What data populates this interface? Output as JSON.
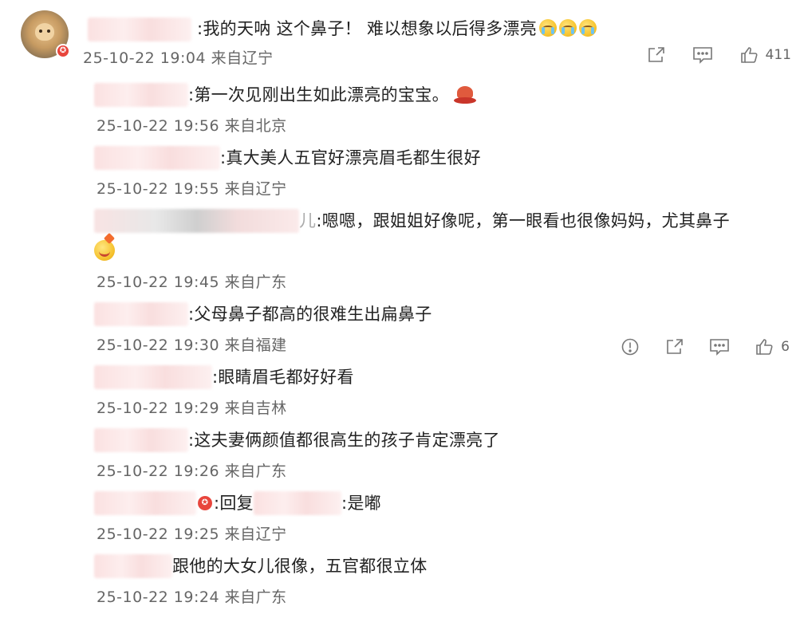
{
  "top_comment": {
    "text": ":我的天呐  这个鼻子！  难以想象以后得多漂亮",
    "emoji_count": 3,
    "emoji_name": "crying-face",
    "meta": "25-10-22 19:04 来自辽宁",
    "like_count": "411",
    "icons": [
      "share-icon",
      "comment-icon",
      "like-icon"
    ]
  },
  "replies": [
    {
      "text": ":第一次见刚出生如此漂亮的宝宝。",
      "meta": "25-10-22 19:56 来自北京",
      "trailing_emoji": "hat-emoji"
    },
    {
      "text": ":真大美人五官好漂亮眉毛都生很好",
      "meta": "25-10-22 19:55 来自辽宁"
    },
    {
      "text": ":嗯嗯，跟姐姐好像呢，第一眼看也很像妈妈，尤其鼻子",
      "meta": "25-10-22 19:45 来自广东",
      "name_suffix": "儿",
      "second_line_emoji": "grinning-face"
    },
    {
      "text": ":父母鼻子都高的很难生出扁鼻子",
      "meta": "25-10-22 19:30 来自福建",
      "like_count": "6",
      "icons": [
        "report-icon",
        "share-icon",
        "comment-icon",
        "like-icon"
      ]
    },
    {
      "text": ":眼睛眉毛都好好看",
      "meta": "25-10-22 19:29 来自吉林"
    },
    {
      "text": ":这夫妻俩颜值都很高生的孩子肯定漂亮了",
      "meta": "25-10-22 19:26 来自广东"
    },
    {
      "text": ":是嘟",
      "reply_prefix": ":回复",
      "meta": "25-10-22 19:25 来自辽宁"
    },
    {
      "text": "跟他的大女儿很像，五官都很立体",
      "meta": "25-10-22 19:24 来自广东"
    }
  ]
}
